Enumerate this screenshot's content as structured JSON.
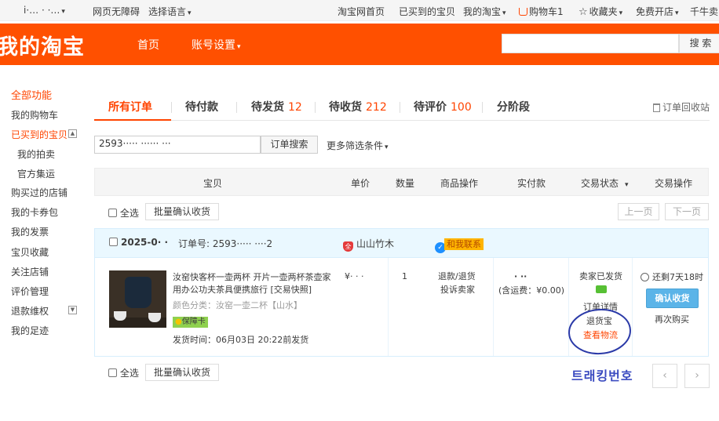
{
  "topbar": {
    "user": "i·… · ·…",
    "accessibility": "网页无障碍",
    "language": "选择语言",
    "home": "淘宝网首页",
    "bought": "已买到的宝贝",
    "my_taobao": "我的淘宝",
    "cart": "购物车1",
    "favorites": "收藏夹",
    "open_store": "免费开店",
    "qianniu": "千牛卖"
  },
  "header": {
    "logo": "我的淘宝",
    "nav_home": "首页",
    "nav_account": "账号设置",
    "search_button": "搜 索"
  },
  "sidebar": {
    "items": [
      "全部功能",
      "我的购物车",
      "已买到的宝贝",
      "我的拍卖",
      "官方集运",
      "购买过的店铺",
      "我的卡券包",
      "我的发票",
      "宝贝收藏",
      "关注店铺",
      "评价管理",
      "退款维权",
      "我的足迹"
    ]
  },
  "tabs": {
    "all": "所有订单",
    "unpaid": "待付款",
    "to_ship": "待发货",
    "to_ship_count": "12",
    "to_receive": "待收货",
    "to_receive_count": "212",
    "to_review": "待评价",
    "to_review_count": "100",
    "installment": "分阶段",
    "recycle": "订单回收站"
  },
  "search": {
    "value": "2593····· ······ ···",
    "button": "订单搜索",
    "more_filters": "更多筛选条件"
  },
  "table_header": [
    "宝贝",
    "单价",
    "数量",
    "商品操作",
    "实付款",
    "交易状态",
    "交易操作"
  ],
  "bulk": {
    "select_all": "全选",
    "batch_confirm": "批量确认收货",
    "prev": "上一页",
    "next": "下一页"
  },
  "order": {
    "date": "2025-0· ·",
    "order_no": "订单号: 2593·····  ····2",
    "shop": "山山竹木",
    "contact": "和我联系",
    "item_title": "汝窑快客杯一壶两杯 开片一壶两杯茶壶家用办公功夫茶具便携旅行 [交易快照]",
    "spec": "颜色分类：汝窑一壶二杯【山水】",
    "guarantee": "保障卡",
    "ship_time": "发货时间：06月03日 20:22前发货",
    "unit_price": "¥· · ·",
    "quantity": "1",
    "ops": [
      "退款/退货",
      "投诉卖家"
    ],
    "paid": "· ··",
    "postage": "(含运费：¥0.00)",
    "status_text": "卖家已发货",
    "order_detail": "订单详情",
    "tuihuobao": "退货宝",
    "logistics": "查看物流",
    "countdown": "还剩7天18时",
    "confirm": "确认收货",
    "rebuy": "再次购买"
  },
  "annotation": "트래킹번호"
}
